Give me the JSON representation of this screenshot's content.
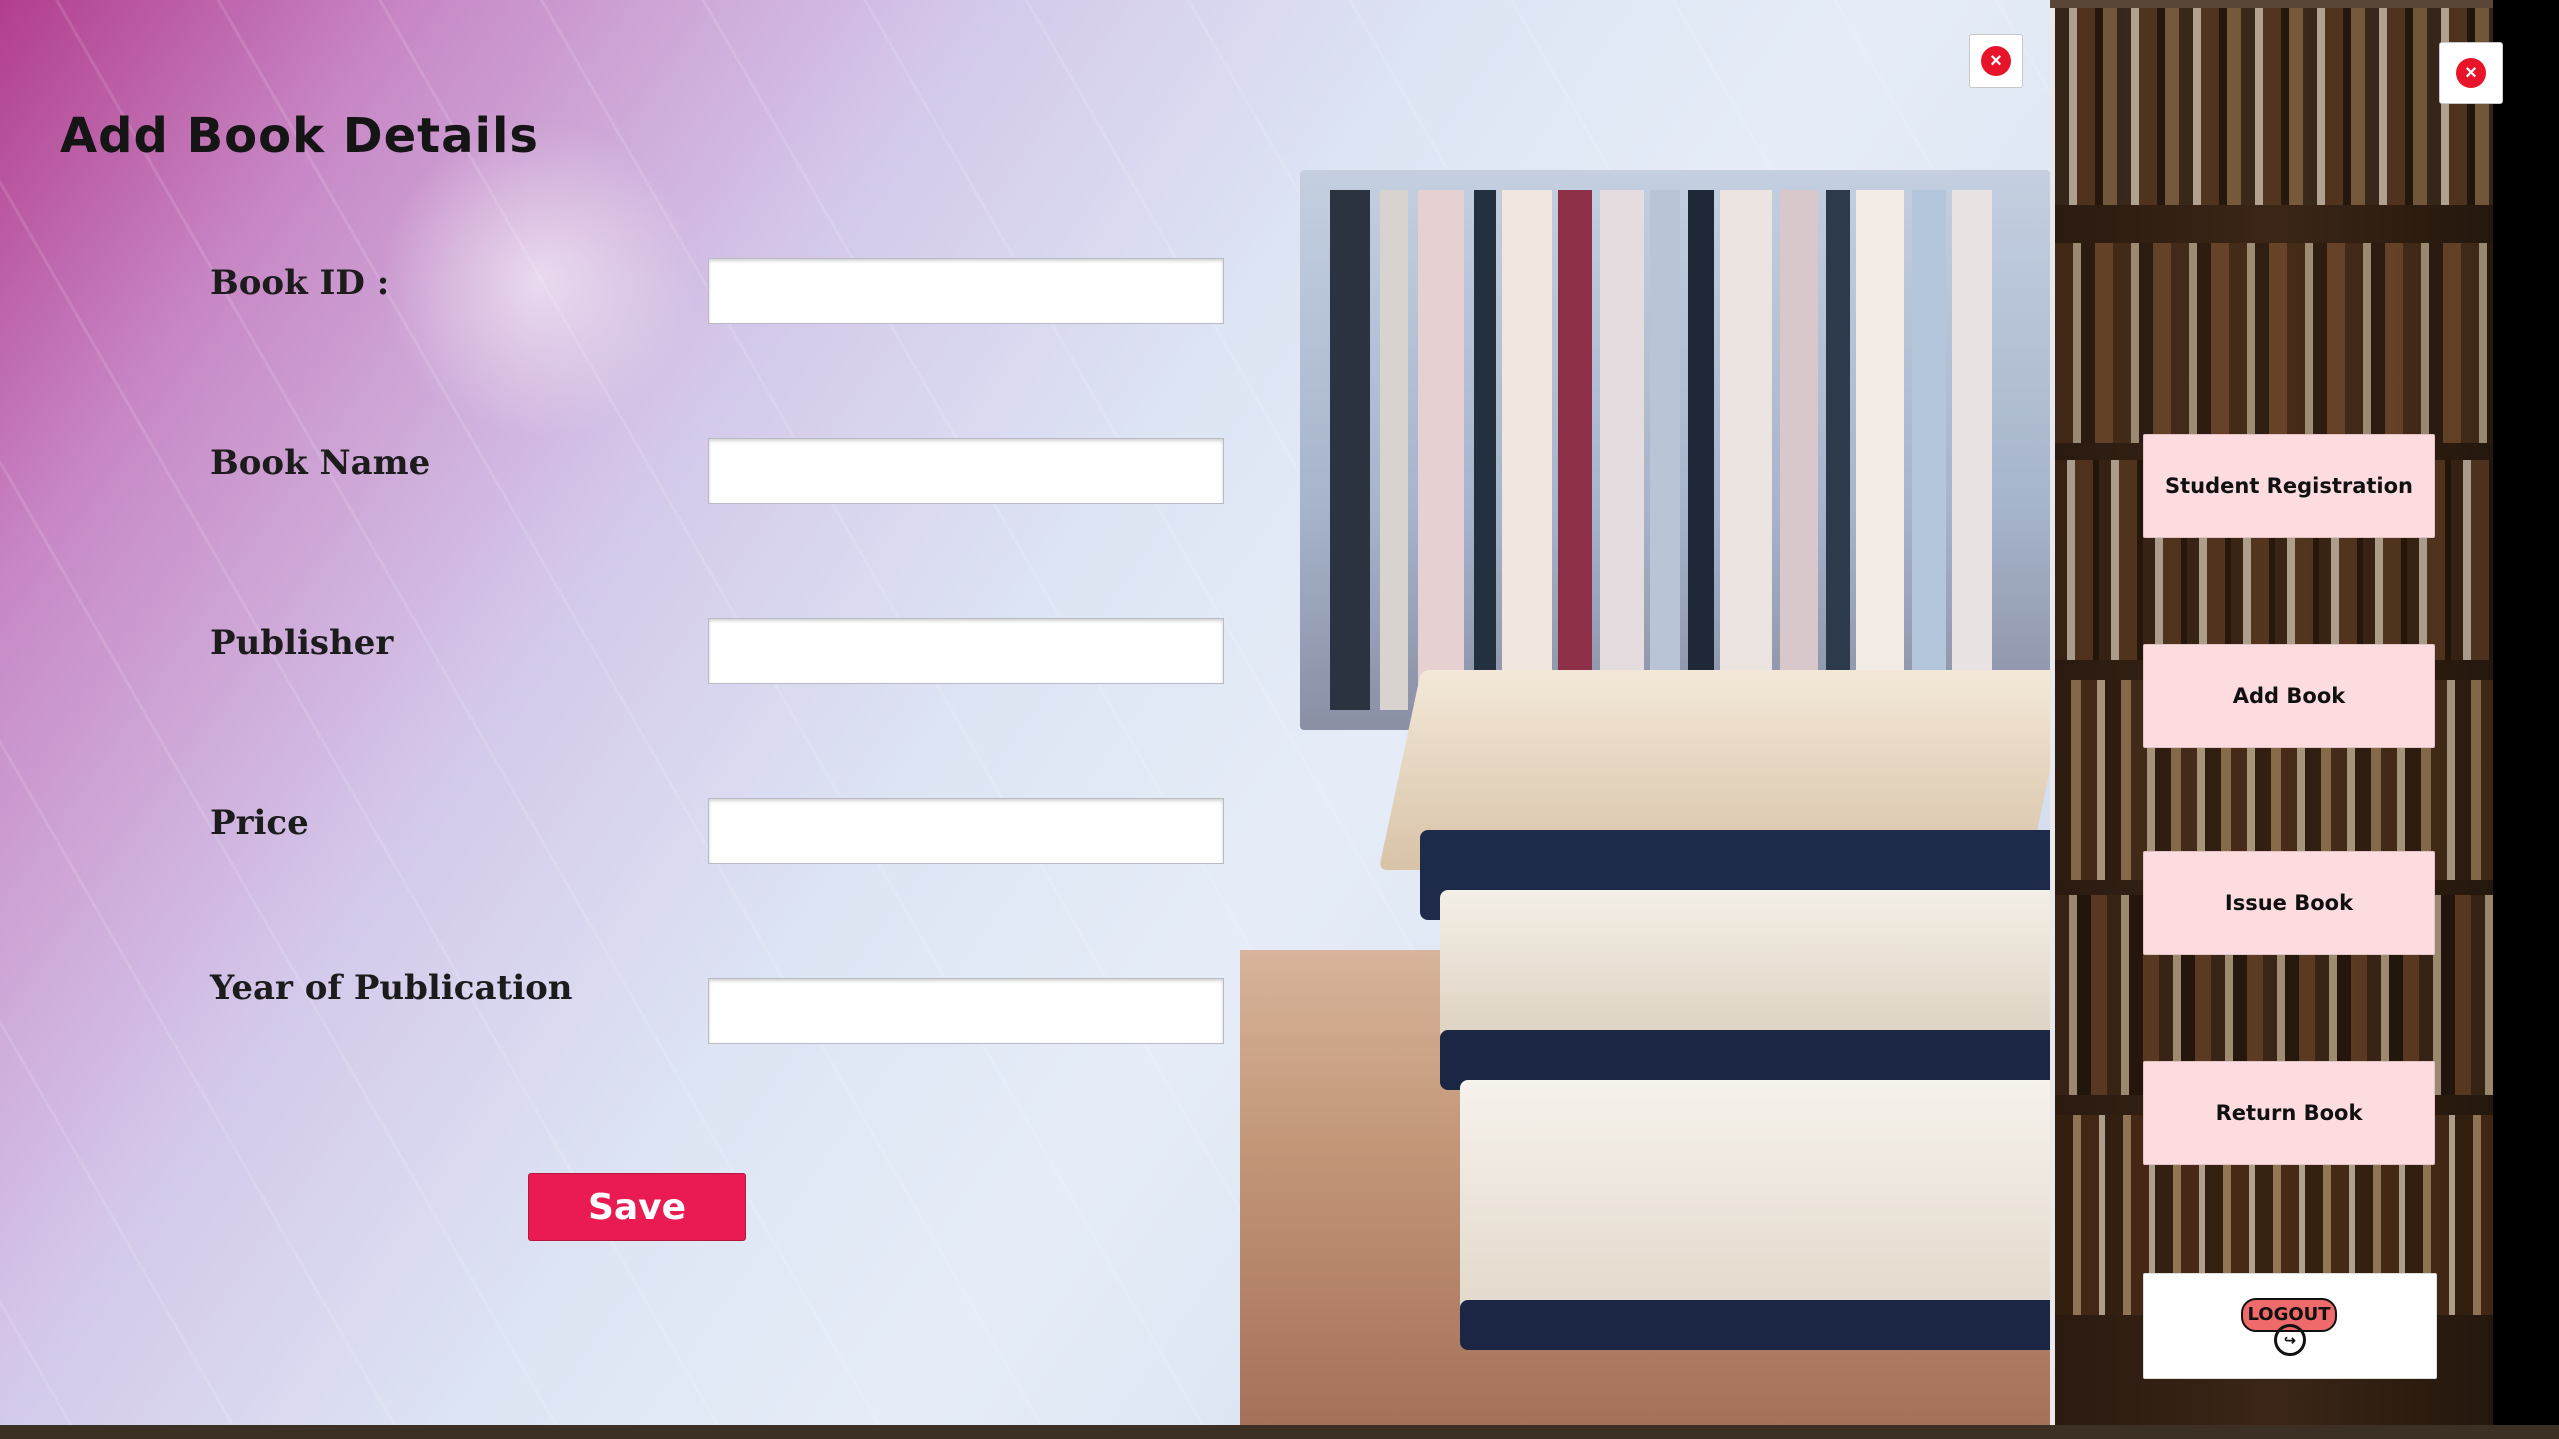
{
  "form": {
    "title": "Add Book Details",
    "fields": [
      {
        "label": "Book ID :",
        "value": ""
      },
      {
        "label": "Book Name",
        "value": ""
      },
      {
        "label": "Publisher",
        "value": ""
      },
      {
        "label": "Price",
        "value": ""
      },
      {
        "label": "Year of Publication",
        "value": ""
      }
    ],
    "save_label": "Save",
    "close_label": "×"
  },
  "nav": {
    "close_label": "×",
    "items": [
      {
        "label": "Student Registration"
      },
      {
        "label": "Add Book"
      },
      {
        "label": "Issue Book"
      },
      {
        "label": "Return Book"
      }
    ],
    "logout_label": "LOGOUT",
    "logout_icon": "↪"
  },
  "colors": {
    "accent": "#ea1a52",
    "nav_button_bg": "#fcdcde",
    "close_icon": "#e8152a"
  }
}
